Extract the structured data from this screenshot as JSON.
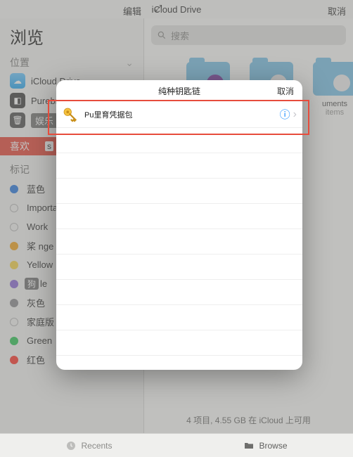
{
  "header": {
    "edit": "编辑",
    "expand_icon": "⤢",
    "title": "iCloud Drive",
    "cancel": "取消"
  },
  "sidebar": {
    "browse_title": "浏览",
    "locations_label": "位置",
    "locations": [
      {
        "label": "iCloud Drive"
      },
      {
        "label": "Purebred"
      },
      {
        "label": "娱乐",
        "selected": true
      }
    ],
    "favorites_label": "喜欢",
    "favorites_item_suffix": "s",
    "tags_label": "标记",
    "tags": [
      {
        "label": "蓝色",
        "color": "#2f7de1",
        "filled": true
      },
      {
        "label": "Important",
        "color": "#bdbdbd",
        "filled": false
      },
      {
        "label": "Work",
        "color": "#bdbdbd",
        "filled": false
      },
      {
        "label": "桨 nge",
        "color": "#f5a623",
        "filled": true
      },
      {
        "label": "Yellow",
        "color": "#f8d64e",
        "filled": true
      },
      {
        "label_prefix": "狗",
        "label_suffix": "le",
        "color": "#8e6dd7",
        "filled": true,
        "pill": true
      },
      {
        "label": "灰色",
        "color": "#8e8e93",
        "filled": true
      },
      {
        "label": "家庭版",
        "color": "#bdbdbd",
        "filled": false
      },
      {
        "label": "Green",
        "color": "#34c759",
        "filled": true
      },
      {
        "label": "红色",
        "color": "#ff3b30",
        "filled": true
      }
    ]
  },
  "search": {
    "placeholder": "搜索"
  },
  "folders": [
    {
      "name": "",
      "meta": "",
      "inner_color": "#7b3fa0"
    },
    {
      "name": "",
      "meta": "",
      "inner_color": "#d9d9d9"
    },
    {
      "name": "uments",
      "meta": "items",
      "inner_color": "#d9d9d9"
    }
  ],
  "footer": {
    "summary": "4 项目, 4.55 GB 在 iCloud 上可用"
  },
  "tabs": {
    "recents": "Recents",
    "browse": "Browse"
  },
  "modal": {
    "title": "纯种钥匙链",
    "cancel": "取消",
    "row": {
      "label": "Pu里育凭据包"
    }
  }
}
